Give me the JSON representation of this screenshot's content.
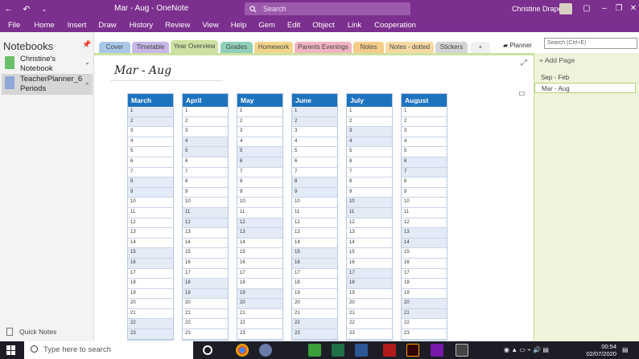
{
  "titlebar": {
    "title": "Mar - Aug  -  OneNote",
    "search_placeholder": "Search",
    "user": "Christine Draper"
  },
  "menu": [
    "File",
    "Home",
    "Insert",
    "Draw",
    "History",
    "Review",
    "View",
    "Help",
    "Gem",
    "Edit",
    "Object",
    "Link",
    "Cooperation"
  ],
  "leftnav": {
    "header": "Notebooks",
    "notebooks": [
      {
        "label": "Christine's Notebook",
        "color": "#6abf69"
      },
      {
        "label": "TeacherPlanner_6 Periods",
        "color": "#8fa8d8"
      }
    ],
    "quick_notes": "Quick Notes"
  },
  "tabs": [
    {
      "label": "Cover",
      "color": "#a9c8e8"
    },
    {
      "label": "Timetable",
      "color": "#c7b6e6"
    },
    {
      "label": "Year Overview",
      "color": "#cde2a2"
    },
    {
      "label": "Grades",
      "color": "#8fd1b8"
    },
    {
      "label": "Homework",
      "color": "#f3d58a"
    },
    {
      "label": "Parents Evenings",
      "color": "#f2b4c0"
    },
    {
      "label": "Notes",
      "color": "#f5cc8a"
    },
    {
      "label": "Notes - dotted",
      "color": "#f7d9a3"
    },
    {
      "label": "Stickers",
      "color": "#d4d4d4"
    },
    {
      "label": "+",
      "color": "#f0f0f0"
    }
  ],
  "planner_label": "Planner",
  "search_box": "Search (Ctrl+E)",
  "page": {
    "title": "Mar - Aug",
    "months": [
      "March",
      "April",
      "May",
      "June",
      "July",
      "August"
    ],
    "days": [
      "1",
      "2",
      "3",
      "4",
      "5",
      "6",
      "7",
      "8",
      "9",
      "10",
      "11",
      "12",
      "13",
      "14",
      "15",
      "16",
      "17",
      "18",
      "19",
      "20",
      "21",
      "22",
      "23"
    ]
  },
  "pagelist": {
    "add_page": "Add Page",
    "pages": [
      "Sep - Feb",
      "Mar - Aug"
    ]
  },
  "taskbar": {
    "search": "Type here to search",
    "time": "00:54",
    "date": "02/07/2020"
  }
}
